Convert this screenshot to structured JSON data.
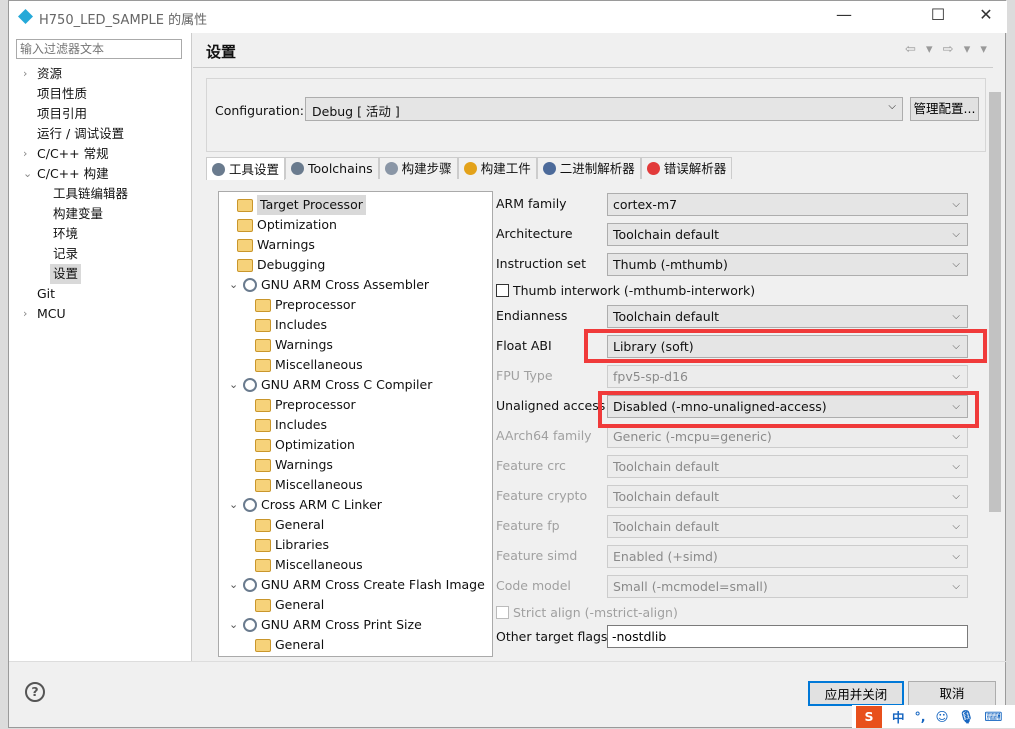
{
  "window": {
    "title": "H750_LED_SAMPLE 的属性",
    "minimize": "—",
    "maximize": "☐",
    "close": "✕"
  },
  "filter": {
    "placeholder": "输入过滤器文本"
  },
  "nav": [
    {
      "label": "资源",
      "chev": "›"
    },
    {
      "label": "项目性质"
    },
    {
      "label": "项目引用"
    },
    {
      "label": "运行 / 调试设置"
    },
    {
      "label": "C/C++ 常规",
      "chev": "›"
    },
    {
      "label": "C/C++ 构建",
      "chev": "⌄"
    },
    {
      "label": "工具链编辑器",
      "sub": true
    },
    {
      "label": "构建变量",
      "sub": true
    },
    {
      "label": "环境",
      "sub": true
    },
    {
      "label": "记录",
      "sub": true
    },
    {
      "label": "设置",
      "sub": true,
      "selected": true
    },
    {
      "label": "Git"
    },
    {
      "label": "MCU",
      "chev": "›"
    }
  ],
  "heading": "设置",
  "nav_arrows": "⇦ ▾ ⇨ ▾ ▾",
  "config": {
    "label": "Configuration:",
    "value": "Debug  [ 活动 ]",
    "manage": "管理配置..."
  },
  "tabs": [
    "工具设置",
    "Toolchains",
    "构建步骤",
    "构建工件",
    "二进制解析器",
    "错误解析器"
  ],
  "tree": [
    {
      "label": "Target Processor",
      "level": 1,
      "selected": true
    },
    {
      "label": "Optimization",
      "level": 1
    },
    {
      "label": "Warnings",
      "level": 1
    },
    {
      "label": "Debugging",
      "level": 1
    },
    {
      "label": "GNU ARM Cross Assembler",
      "level": 0
    },
    {
      "label": "Preprocessor",
      "level": 2
    },
    {
      "label": "Includes",
      "level": 2
    },
    {
      "label": "Warnings",
      "level": 2
    },
    {
      "label": "Miscellaneous",
      "level": 2
    },
    {
      "label": "GNU ARM Cross C Compiler",
      "level": 0
    },
    {
      "label": "Preprocessor",
      "level": 2
    },
    {
      "label": "Includes",
      "level": 2
    },
    {
      "label": "Optimization",
      "level": 2
    },
    {
      "label": "Warnings",
      "level": 2
    },
    {
      "label": "Miscellaneous",
      "level": 2
    },
    {
      "label": "Cross ARM C Linker",
      "level": 0
    },
    {
      "label": "General",
      "level": 2
    },
    {
      "label": "Libraries",
      "level": 2
    },
    {
      "label": "Miscellaneous",
      "level": 2
    },
    {
      "label": "GNU ARM Cross Create Flash Image",
      "level": 0
    },
    {
      "label": "General",
      "level": 2
    },
    {
      "label": "GNU ARM Cross Print Size",
      "level": 0
    },
    {
      "label": "General",
      "level": 2
    }
  ],
  "props": [
    {
      "label": "ARM family",
      "value": "cortex-m7"
    },
    {
      "label": "Architecture",
      "value": "Toolchain default"
    },
    {
      "label": "Instruction set",
      "value": "Thumb (-mthumb)"
    },
    {
      "label": "Thumb interwork (-mthumb-interwork)",
      "check": true
    },
    {
      "label": "Endianness",
      "value": "Toolchain default"
    },
    {
      "label": "Float ABI",
      "value": "Library (soft)",
      "highlight": true
    },
    {
      "label": "FPU Type",
      "value": "fpv5-sp-d16",
      "disabled": true
    },
    {
      "label": "Unaligned access",
      "value": "Disabled (-mno-unaligned-access)",
      "highlight": true
    },
    {
      "label": "AArch64 family",
      "value": "Generic (-mcpu=generic)",
      "disabled": true
    },
    {
      "label": "Feature crc",
      "value": "Toolchain default",
      "disabled": true
    },
    {
      "label": "Feature crypto",
      "value": "Toolchain default",
      "disabled": true
    },
    {
      "label": "Feature fp",
      "value": "Toolchain default",
      "disabled": true
    },
    {
      "label": "Feature simd",
      "value": "Enabled (+simd)",
      "disabled": true
    },
    {
      "label": "Code model",
      "value": "Small (-mcmodel=small)",
      "disabled": true
    },
    {
      "label": "Strict align (-mstrict-align)",
      "check": true,
      "disabled": true
    },
    {
      "label": "Other target flags",
      "value": "-nostdlib",
      "text": true
    }
  ],
  "buttons": {
    "help": "?",
    "apply_close": "应用并关闭",
    "cancel": "取消"
  },
  "ime": {
    "logo": "S",
    "lang": "中",
    "punct": "°,"
  },
  "colors": {
    "highlight": "#f03a3a",
    "accent": "#0078d7"
  }
}
